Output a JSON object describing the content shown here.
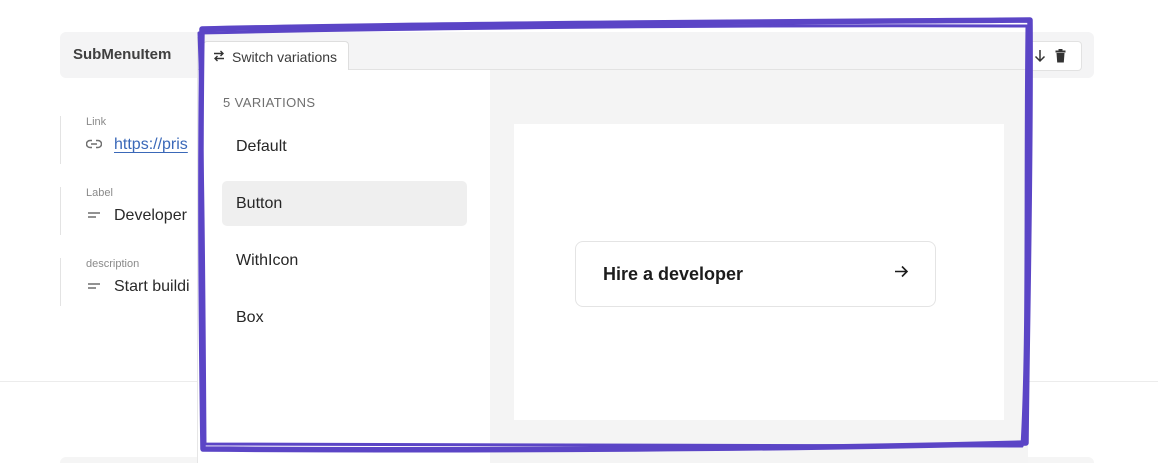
{
  "slice": {
    "name": "SubMenuItem",
    "toolbar": {
      "move_up_icon": "arrow-up-icon",
      "move_down_icon": "arrow-down-icon",
      "delete_icon": "trash-icon"
    }
  },
  "fields": [
    {
      "label": "Link",
      "value": "https://pris",
      "icon": "link-icon"
    },
    {
      "label": "Label",
      "value": "Developer",
      "icon": "text-icon"
    },
    {
      "label": "description",
      "value": "Start buildi",
      "icon": "text-icon"
    }
  ],
  "popover": {
    "tab_label": "Switch variations",
    "count_label": "5 VARIATIONS",
    "variations": [
      {
        "label": "Default",
        "selected": false
      },
      {
        "label": "Button",
        "selected": true
      },
      {
        "label": "WithIcon",
        "selected": false
      },
      {
        "label": "Box",
        "selected": false
      }
    ],
    "preview": {
      "button_label": "Hire a developer",
      "button_icon": "arrow-right-icon"
    }
  },
  "colors": {
    "annotation": "#5B45C6",
    "link": "#3A68B8",
    "selected_bg": "#EFEFEF"
  }
}
